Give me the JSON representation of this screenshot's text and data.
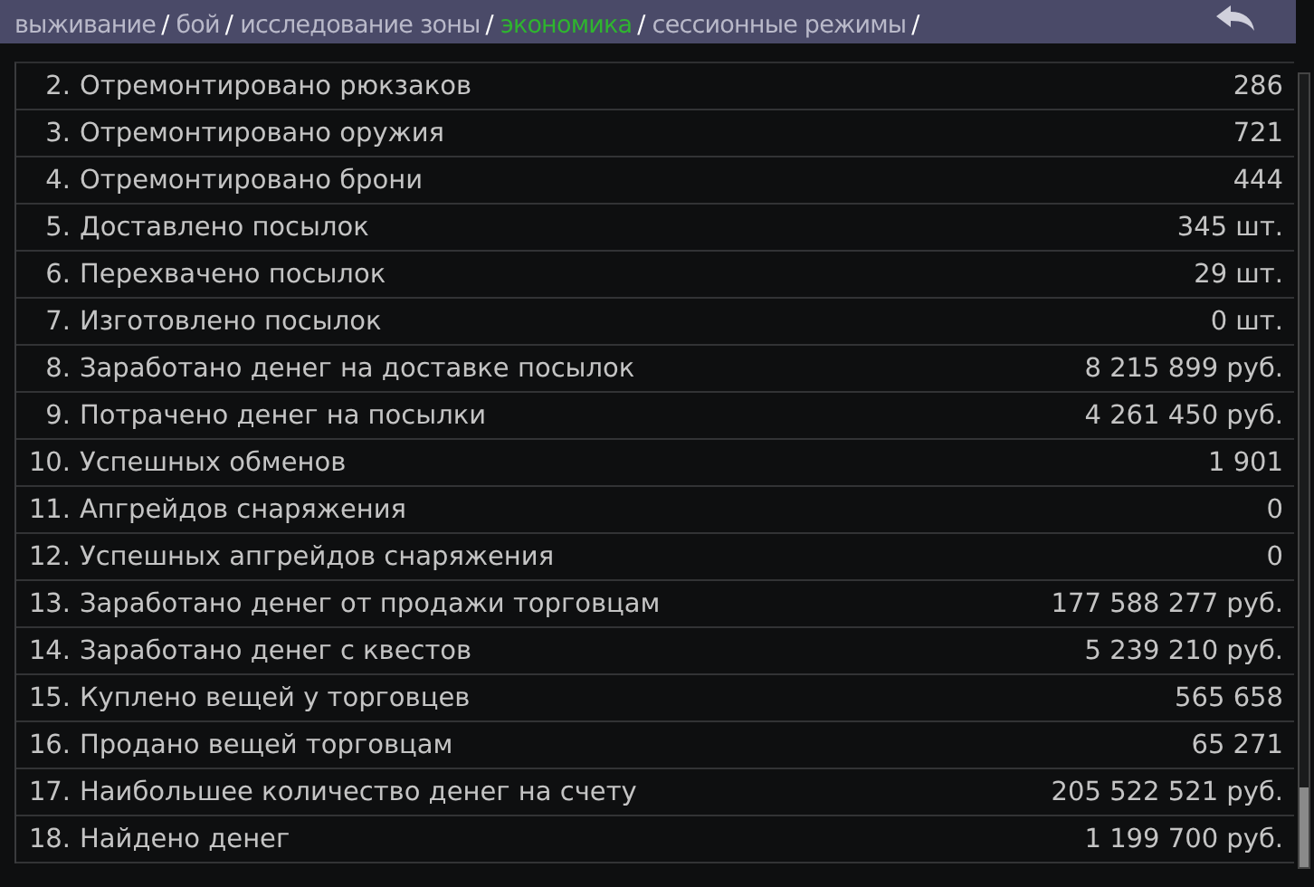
{
  "breadcrumbs": [
    {
      "label": "выживание",
      "separator": "/",
      "selected": false
    },
    {
      "label": "бой",
      "separator": "/",
      "selected": false
    },
    {
      "label": "исследование зоны",
      "separator": "/",
      "selected": false
    },
    {
      "label": "экономика",
      "separator": "/",
      "selected": true
    },
    {
      "label": "сессионные режимы",
      "separator": "/",
      "selected": false
    }
  ],
  "rows": [
    {
      "number": "2.",
      "label": "Отремонтировано рюкзаков",
      "value": "286"
    },
    {
      "number": "3.",
      "label": "Отремонтировано оружия",
      "value": "721"
    },
    {
      "number": "4.",
      "label": "Отремонтировано брони",
      "value": "444"
    },
    {
      "number": "5.",
      "label": "Доставлено посылок",
      "value": "345 шт."
    },
    {
      "number": "6.",
      "label": "Перехвачено посылок",
      "value": "29 шт."
    },
    {
      "number": "7.",
      "label": "Изготовлено посылок",
      "value": "0 шт."
    },
    {
      "number": "8.",
      "label": "Заработано денег на доставке посылок",
      "value": "8 215 899 руб."
    },
    {
      "number": "9.",
      "label": "Потрачено денег на посылки",
      "value": "4 261 450 руб."
    },
    {
      "number": "10.",
      "label": "Успешных обменов",
      "value": "1 901"
    },
    {
      "number": "11.",
      "label": "Апгрейдов снаряжения",
      "value": "0"
    },
    {
      "number": "12.",
      "label": "Успешных апгрейдов снаряжения",
      "value": "0"
    },
    {
      "number": "13.",
      "label": "Заработано денег от продажи торговцам",
      "value": "177 588 277 руб."
    },
    {
      "number": "14.",
      "label": "Заработано денег с квестов",
      "value": "5 239 210 руб."
    },
    {
      "number": "15.",
      "label": "Куплено вещей у торговцев",
      "value": "565 658"
    },
    {
      "number": "16.",
      "label": "Продано вещей торговцам",
      "value": "65 271"
    },
    {
      "number": "17.",
      "label": "Наибольшее количество денег на счету",
      "value": "205 522 521 руб."
    },
    {
      "number": "18.",
      "label": "Найдено денег",
      "value": "1 199 700 руб."
    }
  ]
}
